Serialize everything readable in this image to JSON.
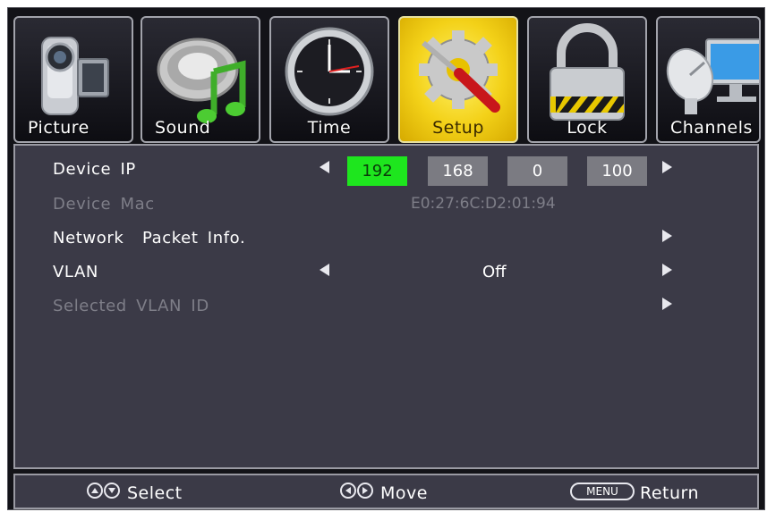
{
  "tabs": [
    {
      "label": "Picture",
      "icon": "camcorder-icon"
    },
    {
      "label": "Sound",
      "icon": "speaker-music-note-icon"
    },
    {
      "label": "Time",
      "icon": "clock-icon"
    },
    {
      "label": "Setup",
      "icon": "gear-screwdriver-icon",
      "active": true
    },
    {
      "label": "Lock",
      "icon": "padlock-icon"
    },
    {
      "label": "Channels",
      "icon": "satellite-dish-monitor-icon"
    }
  ],
  "rows": {
    "device_ip": {
      "label": "Device IP",
      "octets": [
        "192",
        "168",
        "0",
        "100"
      ]
    },
    "device_mac": {
      "label": "Device Mac",
      "value": "E0:27:6C:D2:01:94"
    },
    "network_packet": {
      "label": "Network  Packet Info."
    },
    "vlan": {
      "label": "VLAN",
      "value": "Off"
    },
    "selected_vlan": {
      "label": "Selected VLAN ID"
    }
  },
  "footer": {
    "select": "Select",
    "move": "Move",
    "menu_key": "MENU",
    "return": "Return"
  },
  "colors": {
    "panel": "#3b3a47",
    "selected_octet": "#1ee61e",
    "active_tab": "#f3d118",
    "disabled_text": "#7e7e88"
  }
}
